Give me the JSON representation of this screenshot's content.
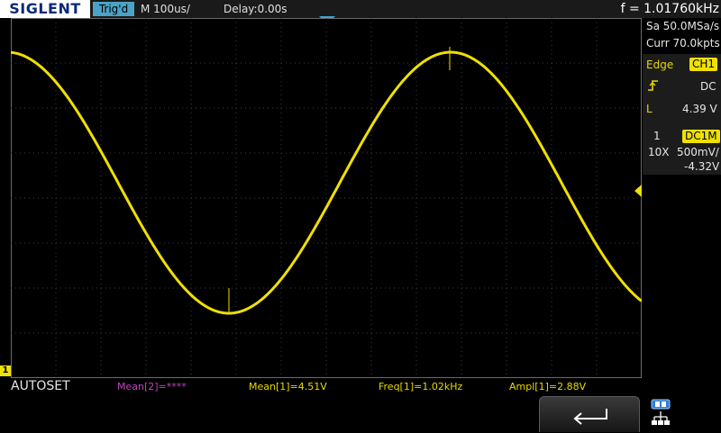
{
  "header": {
    "logo": "SIGLENT",
    "trigger_state": "Trig'd",
    "timebase": "M 100us/",
    "delay": "Delay:0.00s",
    "frequency": "f = 1.01760kHz"
  },
  "side_panel": {
    "sample_rate": "Sa 50.0MSa/s",
    "memory_depth": "Curr 70.0kpts",
    "trigger": {
      "type": "Edge",
      "source": "CH1",
      "coupling": "DC",
      "slope_icon": "rising-edge-icon",
      "level_label": "L",
      "level_value": "4.39 V"
    },
    "channel": {
      "number": "1",
      "coupling": "DC1M",
      "probe": "10X",
      "scale": "500mV/",
      "offset": "-4.32V"
    }
  },
  "grid": {
    "channel_marker": "1"
  },
  "measurements": {
    "autoset": "AUTOSET",
    "mean2": "Mean[2]=****",
    "mean1": "Mean[1]=4.51V",
    "freq1": "Freq[1]=1.02kHz",
    "ampl1": "Ampl[1]=2.88V"
  },
  "softkeys": {
    "back_icon": "return-arrow-icon",
    "network_icon": "network-icon"
  },
  "colors": {
    "ch1": "#f0e000",
    "trigger_marker": "#3fa6d6",
    "mean2": "#c040c0",
    "trig_badge": "#4aa3c7"
  }
}
